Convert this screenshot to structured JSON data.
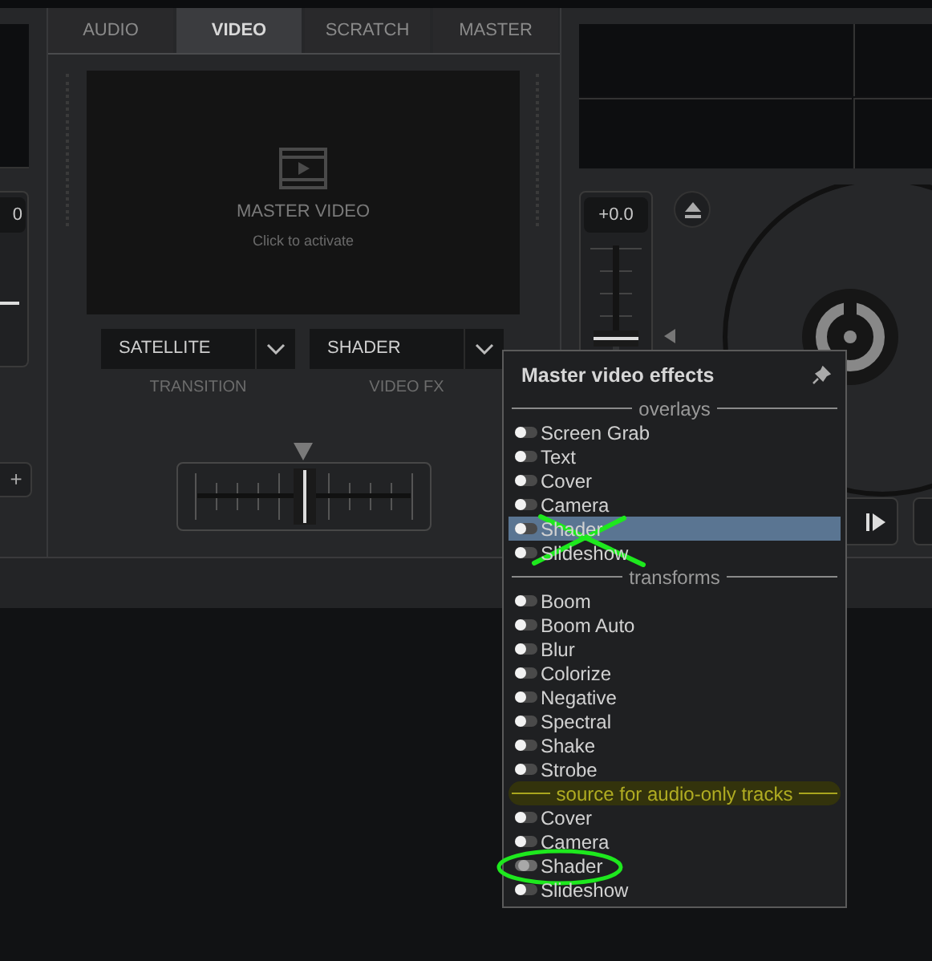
{
  "deck_left": {
    "pitch_reading": "0",
    "pitch_slider": {
      "level": 0.5
    },
    "button": "+"
  },
  "tabs": [
    {
      "label": "AUDIO",
      "selected": false
    },
    {
      "label": "VIDEO",
      "selected": true
    },
    {
      "label": "SCRATCH",
      "selected": false
    },
    {
      "label": "MASTER",
      "selected": false
    }
  ],
  "video_preview": {
    "title": "MASTER VIDEO",
    "subtitle": "Click to activate"
  },
  "dropdowns": [
    {
      "value": "SATELLITE",
      "label": "TRANSITION"
    },
    {
      "value": "SHADER",
      "label": "VIDEO FX"
    }
  ],
  "deck_right": {
    "pitch_reading": "+0.0",
    "pitch_slider": {
      "level": 0.2
    }
  },
  "effects_menu": {
    "title": "Master video effects",
    "sections": [
      {
        "title": "overlays",
        "highlighted": false,
        "items": [
          {
            "label": "Screen Grab",
            "selected": false,
            "on": false
          },
          {
            "label": "Text",
            "selected": false,
            "on": false
          },
          {
            "label": "Cover",
            "selected": false,
            "on": false
          },
          {
            "label": "Camera",
            "selected": false,
            "on": false
          },
          {
            "label": "Shader",
            "selected": true,
            "on": false
          },
          {
            "label": "Slideshow",
            "selected": false,
            "on": false
          }
        ]
      },
      {
        "title": "transforms",
        "highlighted": false,
        "items": [
          {
            "label": "Boom",
            "selected": false,
            "on": false
          },
          {
            "label": "Boom Auto",
            "selected": false,
            "on": false
          },
          {
            "label": "Blur",
            "selected": false,
            "on": false
          },
          {
            "label": "Colorize",
            "selected": false,
            "on": false
          },
          {
            "label": "Negative",
            "selected": false,
            "on": false
          },
          {
            "label": "Spectral",
            "selected": false,
            "on": false
          },
          {
            "label": "Shake",
            "selected": false,
            "on": false
          },
          {
            "label": "Strobe",
            "selected": false,
            "on": false
          }
        ]
      },
      {
        "title": "source for audio-only tracks",
        "highlighted": true,
        "items": [
          {
            "label": "Cover",
            "selected": false,
            "on": false
          },
          {
            "label": "Camera",
            "selected": false,
            "on": false
          },
          {
            "label": "Shader",
            "selected": false,
            "on": true
          },
          {
            "label": "Slideshow",
            "selected": false,
            "on": false
          }
        ]
      }
    ]
  }
}
